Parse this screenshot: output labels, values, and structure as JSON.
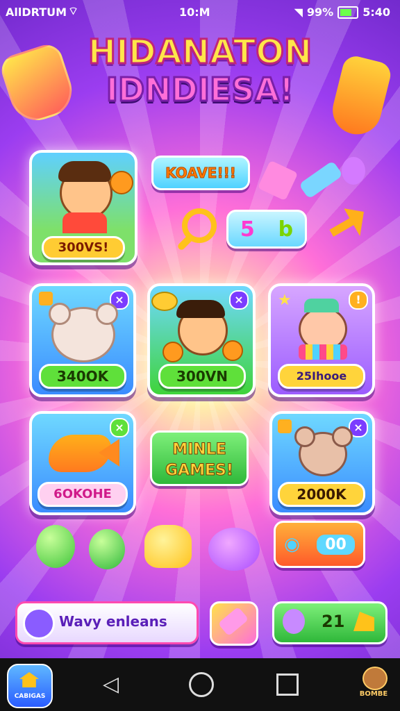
{
  "status_bar": {
    "carrier": "AllDRTUM",
    "time": "10:M",
    "battery_percent": "99%",
    "extra": "5:40",
    "icons": [
      "wifi-icon",
      "signal-icon",
      "battery-icon"
    ]
  },
  "title": {
    "line1": "HIDANATON",
    "line2": "IDNDIESA!"
  },
  "featured": {
    "reward": "300VS!",
    "badge": "KOAVE!!!",
    "counter_a": "5",
    "counter_b": "b"
  },
  "cards": [
    {
      "value": "340OK",
      "icon": "bear-icon",
      "close": "×"
    },
    {
      "value": "300VN",
      "icon": "kid-icon",
      "close": "×"
    },
    {
      "value": "25Ihooe",
      "icon": "cat-icon",
      "close": "!"
    },
    {
      "value": "6OKOHE",
      "icon": "fish-icon",
      "close": "×"
    },
    {
      "value": "2000K",
      "icon": "mouse-icon",
      "close": "×"
    }
  ],
  "mini_games": {
    "line1": "MINLE",
    "line2": "GAMES!"
  },
  "controller_badge": "00",
  "bottom": {
    "search_placeholder": "Wavy enleans",
    "count": "21"
  },
  "nav": {
    "home_label": "CABIGAS",
    "profile_label": "BOMBE"
  },
  "colors": {
    "accent_purple": "#7b3cff",
    "accent_green": "#3fd43a",
    "accent_orange": "#ff9a1f",
    "pill_yellow": "#ffd43b"
  }
}
